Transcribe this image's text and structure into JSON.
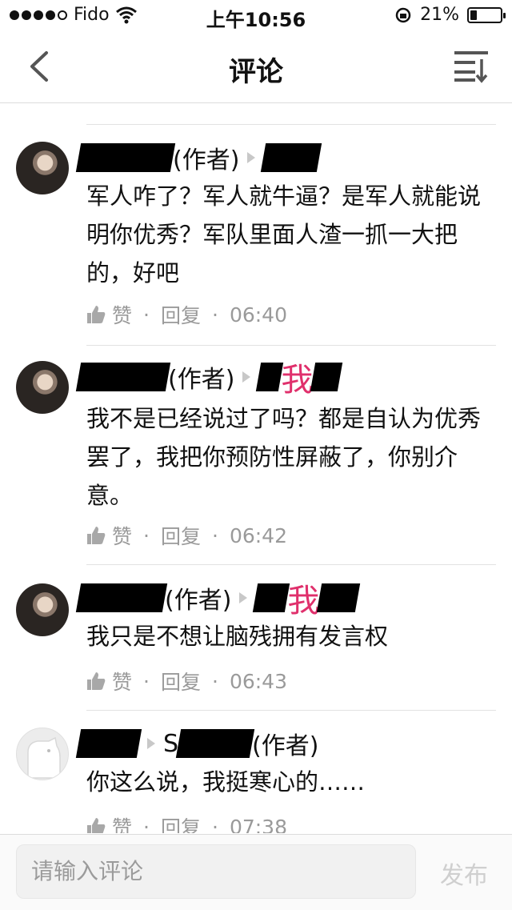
{
  "status_bar": {
    "carrier": "Fido",
    "time": "上午10:56",
    "battery": "21%",
    "battery_level": 0.21
  },
  "nav": {
    "title": "评论",
    "back_icon": "chevron-left-icon",
    "sort_icon": "sort-icon"
  },
  "comments": [
    {
      "author_suffix": "(作者)",
      "reply_target": "",
      "text": "军人咋了？军人就牛逼？是军人就能说明你优秀？军队里面人渣一抓一大把的，好吧",
      "like": "赞",
      "reply": "回复",
      "time": "06:40"
    },
    {
      "author_suffix": "(作者)",
      "reply_target": "我",
      "text": "我不是已经说过了吗？都是自认为优秀罢了，我把你预防性屏蔽了，你别介意。",
      "like": "赞",
      "reply": "回复",
      "time": "06:42"
    },
    {
      "author_suffix": "(作者)",
      "reply_target": "我",
      "text": "我只是不想让脑残拥有发言权",
      "like": "赞",
      "reply": "回复",
      "time": "06:43"
    },
    {
      "author_suffix": "(作者)",
      "reply_prefix": "S",
      "text": "你这么说，我挺寒心的……",
      "like": "赞",
      "reply": "回复",
      "time": "07:38"
    }
  ],
  "composer": {
    "placeholder": "请输入评论",
    "publish": "发布"
  },
  "colors": {
    "accent_pink": "#e0306c",
    "muted_text": "#9a9a9a"
  }
}
